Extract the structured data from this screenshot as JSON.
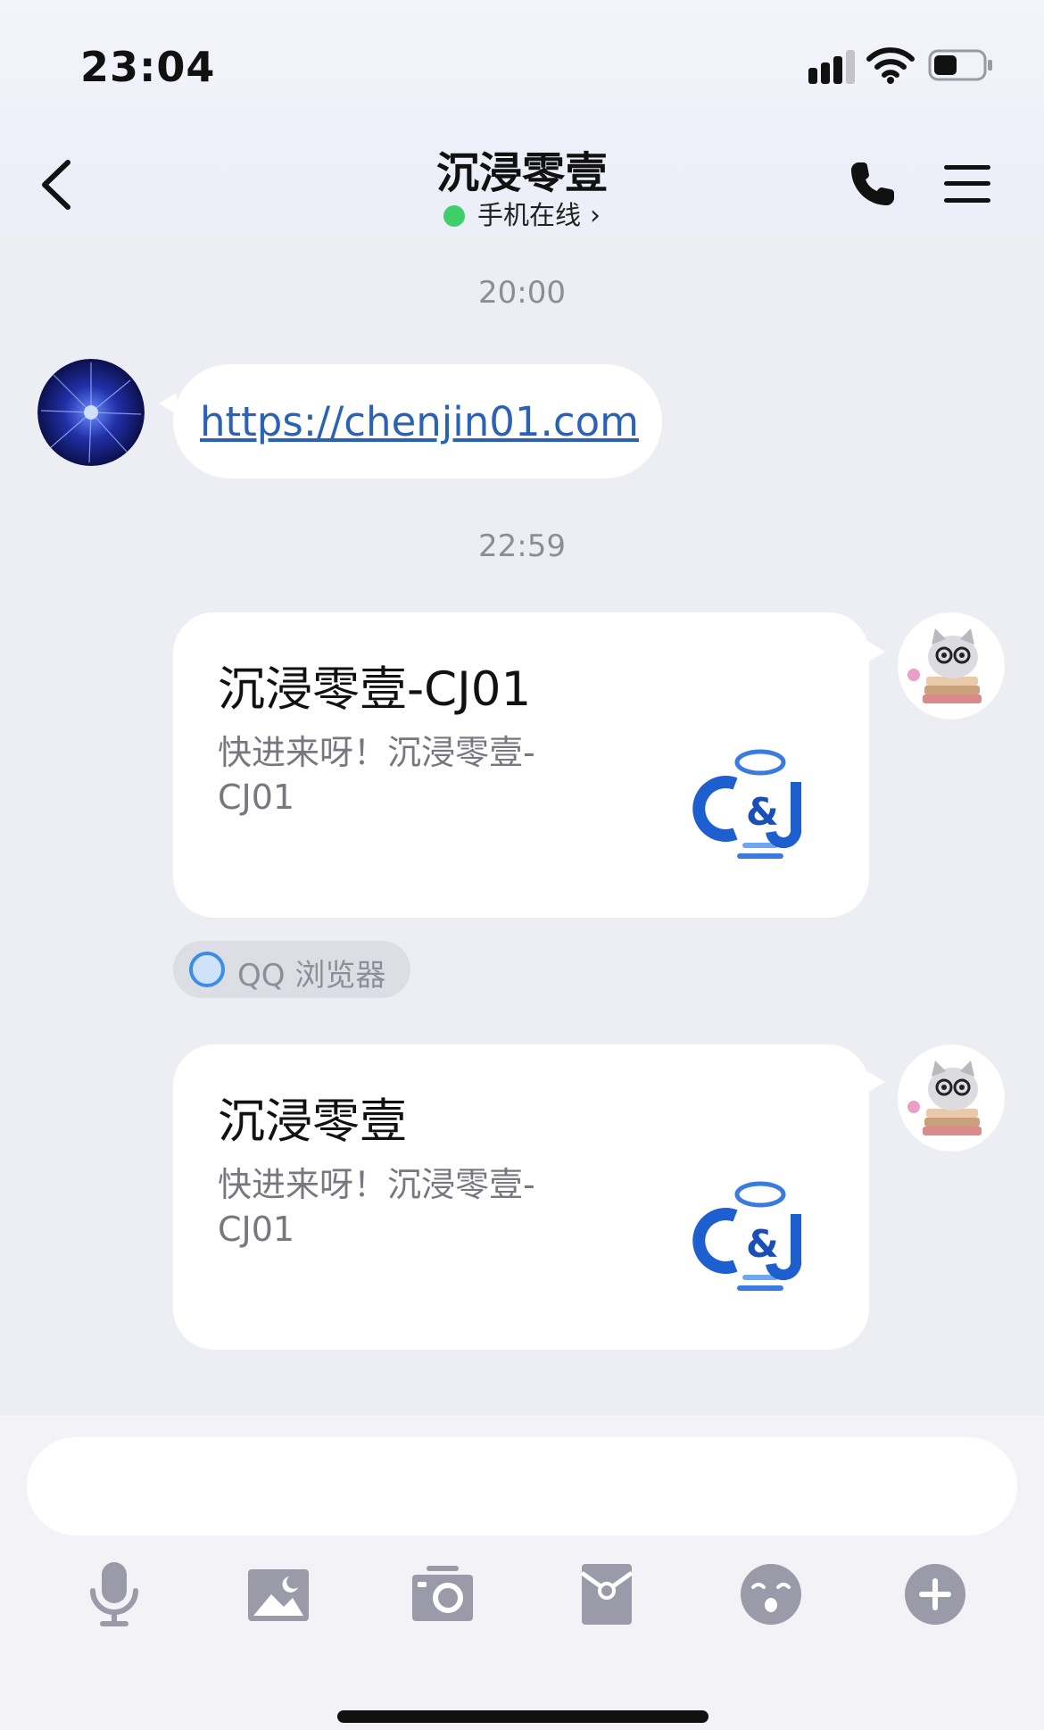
{
  "status_bar": {
    "time": "23:04",
    "battery_level": 0.45
  },
  "header": {
    "title": "沉浸零壹",
    "presence": "手机在线",
    "presence_color": "#3ecf6a"
  },
  "messages": {
    "time1": "20:00",
    "link": "https://chenjin01.com",
    "time2": "22:59",
    "card1": {
      "title": "沉浸零壹-CJ01",
      "desc": "快进来呀！沉浸零壹-CJ01"
    },
    "source": "QQ 浏览器",
    "card2": {
      "title": "沉浸零壹",
      "desc": "快进来呀！沉浸零壹-CJ01"
    }
  },
  "toolbar": {
    "items": [
      "microphone-icon",
      "image-icon",
      "camera-icon",
      "red-packet-icon",
      "emoji-icon",
      "plus-icon"
    ]
  },
  "colors": {
    "background": "#ededf4",
    "link": "#2a63b6",
    "icon_gray": "#9a9aa8"
  }
}
